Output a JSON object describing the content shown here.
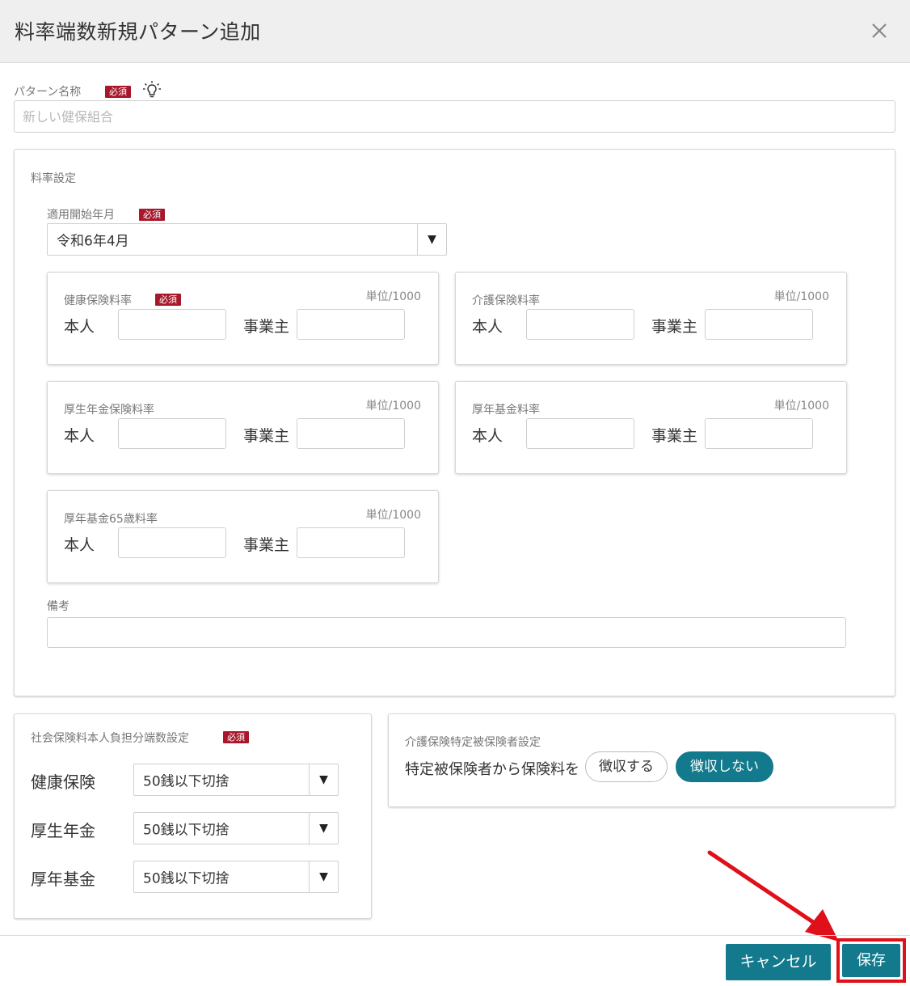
{
  "header": {
    "title": "料率端数新規パターン追加",
    "close_icon": "close-icon"
  },
  "pattern_name": {
    "label": "パターン名称",
    "required": "必須",
    "placeholder": "新しい健保組合",
    "value": ""
  },
  "rate_settings": {
    "title": "料率設定",
    "start": {
      "label": "適用開始年月",
      "required": "必須",
      "value": "令和6年4月"
    },
    "cards": [
      {
        "title": "健康保険料率",
        "required": "必須",
        "unit": "単位/1000",
        "self_label": "本人",
        "employer_label": "事業主"
      },
      {
        "title": "介護保険料率",
        "unit": "単位/1000",
        "self_label": "本人",
        "employer_label": "事業主"
      },
      {
        "title": "厚生年金保険料率",
        "unit": "単位/1000",
        "self_label": "本人",
        "employer_label": "事業主"
      },
      {
        "title": "厚年基金料率",
        "unit": "単位/1000",
        "self_label": "本人",
        "employer_label": "事業主"
      },
      {
        "title": "厚年基金65歳料率",
        "unit": "単位/1000",
        "self_label": "本人",
        "employer_label": "事業主"
      }
    ],
    "remarks": {
      "label": "備考",
      "value": ""
    }
  },
  "rounding": {
    "title": "社会保険料本人負担分端数設定",
    "required": "必須",
    "rows": [
      {
        "label": "健康保険",
        "value": "50銭以下切捨"
      },
      {
        "label": "厚生年金",
        "value": "50銭以下切捨"
      },
      {
        "label": "厚年基金",
        "value": "50銭以下切捨"
      }
    ]
  },
  "care": {
    "title": "介護保険特定被保険者設定",
    "prompt": "特定被保険者から保険料を",
    "collect": "徴収する",
    "no_collect": "徴収しない"
  },
  "footer": {
    "cancel": "キャンセル",
    "save": "保存"
  },
  "colors": {
    "accent": "#127a8c",
    "required_badge": "#a8172b",
    "highlight": "#e0101a"
  }
}
